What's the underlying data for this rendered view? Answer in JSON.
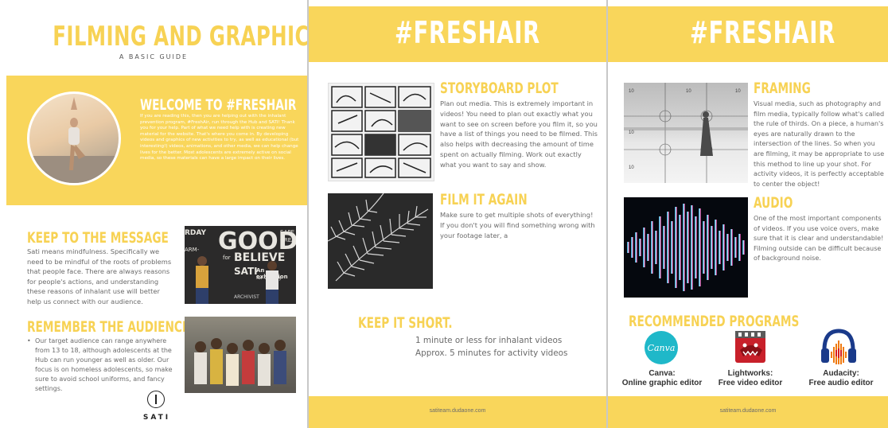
{
  "page1": {
    "title": "FILMING AND GRAPHICS",
    "subtitle": "A BASIC GUIDE",
    "welcome_heading": "WELCOME TO #FRESHAIR",
    "welcome_body": "If you are reading this, then you are helping out with the inhalant prevention program, #FreshAir, run through the Hub and SATI! Thank you for your help. Part of what we need help with is creating new material for the website. That's where you come in. By developing videos and graphics of new activities to try, as well as educational (but interesting!) videos, animations, and other media, we can help change lives for the better. Most adolescents are extremely active on social media, so these materials can have a large impact on their lives.",
    "keep_heading": "KEEP TO THE MESSAGE",
    "keep_body": "Sati means mindfulness. Specifically we need to be mindful of the roots of problems that people face. There are always reasons for people's actions, and understanding these reasons of inhalant use will better help us connect with our audience.",
    "poster_lines": [
      "GOOD",
      "BELIEVE",
      "SATI",
      "An exhibition",
      "for Charity",
      "ARCHIVIST",
      "RDAY",
      "SAPE",
      "CREA",
      "for",
      "ARM-"
    ],
    "remember_heading": "REMEMBER THE AUDIENCE",
    "remember_body": "Our target audience can range anywhere from 13 to 18, although adolescents at the Hub can run younger as well as older. Our focus is on homeless adolescents, so make sure to avoid school uniforms, and fancy settings.",
    "logo_text": "SATI"
  },
  "page2": {
    "header": "#FRESHAIR",
    "storyboard_heading": "STORYBOARD PLOT",
    "storyboard_body": "Plan out media. This is extremely important in videos! You need to plan out exactly what you want to see on screen before you film it, so you have a list of things you need to be filmed. This also helps with decreasing the amount of time spent on actually filming. Work out exactly what you want to say and show.",
    "film_heading": "FILM IT AGAIN",
    "film_body": "Make sure to get multiple shots of everything! If you don't you will find something wrong with your footage later, a",
    "short_heading": "KEEP IT SHORT.",
    "short_line1": "1 minute or less for inhalant videos",
    "short_line2": "Approx. 5 minutes for activity videos",
    "footer": "satiteam.dudaone.com"
  },
  "page3": {
    "header": "#FRESHAIR",
    "framing_heading": "FRAMING",
    "framing_body": "Visual media, such as photography and film media, typically follow what's called the rule of thirds. On a piece, a human's eyes are naturally drawn to the intersection of the lines. So when you are filming, it may be appropriate to use this method to line up your shot. For activity videos, it is perfectly acceptable to center the object!",
    "grid_labels": [
      "10",
      "10",
      "10",
      "10",
      "10"
    ],
    "audio_heading": "AUDIO",
    "audio_body": "One of the most important components of videos. If you use voice overs, make sure that it is clear and understandable! Filming outside can be difficult because of background noise.",
    "programs_heading": "RECOMMENDED PROGRAMS",
    "canva_logo_text": "Canva",
    "programs": [
      {
        "name": "Canva:",
        "desc": "Online graphic editor"
      },
      {
        "name": "Lightworks:",
        "desc": "Free video editor"
      },
      {
        "name": "Audacity:",
        "desc": "Free audio editor"
      }
    ],
    "footer": "satiteam.dudaone.com"
  },
  "colors": {
    "accent": "#f9d65b",
    "heading": "#f7d254",
    "text": "#6a6a6a"
  }
}
